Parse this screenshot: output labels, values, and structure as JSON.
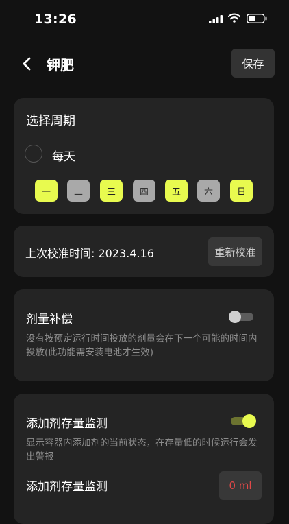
{
  "status": {
    "time": "13:26"
  },
  "nav": {
    "title": "钾肥",
    "save_label": "保存"
  },
  "period": {
    "title": "选择周期",
    "daily_label": "每天",
    "days": [
      {
        "label": "一",
        "selected": true
      },
      {
        "label": "二",
        "selected": false
      },
      {
        "label": "三",
        "selected": true
      },
      {
        "label": "四",
        "selected": false
      },
      {
        "label": "五",
        "selected": true
      },
      {
        "label": "六",
        "selected": false
      },
      {
        "label": "日",
        "selected": true
      }
    ]
  },
  "calibration": {
    "text": "上次校准时间: 2023.4.16",
    "button_label": "重新校准"
  },
  "compensation": {
    "title": "剂量补偿",
    "enabled": false,
    "desc": "没有按预定运行时间投放的剂量会在下一个可能的时间内投放(此功能需安装电池才生效)"
  },
  "monitor": {
    "title": "添加剂存量监测",
    "enabled": true,
    "desc": "显示容器内添加剂的当前状态，在存量低的时候运行会发出警报",
    "sub_label": "添加剂存量监测",
    "amount": "0 ml"
  },
  "colors": {
    "accent": "#e8fa4f",
    "background": "#121212",
    "card": "#242424",
    "warning": "#e04848"
  }
}
